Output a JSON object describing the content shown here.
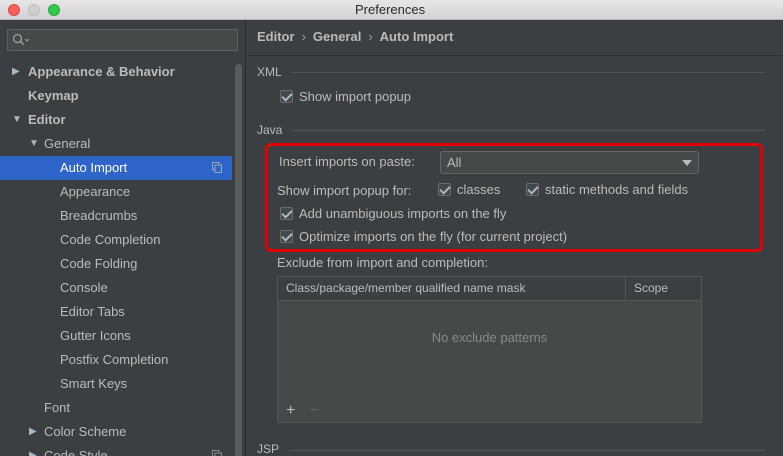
{
  "window": {
    "title": "Preferences"
  },
  "search": {
    "placeholder": ""
  },
  "sidebar": {
    "items": [
      {
        "label": "Appearance & Behavior",
        "arrow": "▶",
        "bold": true
      },
      {
        "label": "Keymap",
        "arrow": "",
        "bold": true
      },
      {
        "label": "Editor",
        "arrow": "▼",
        "bold": true
      },
      {
        "label": "General",
        "arrow": "▼",
        "bold": false
      },
      {
        "label": "Auto Import",
        "arrow": "",
        "bold": false,
        "selected": true
      },
      {
        "label": "Appearance",
        "arrow": "",
        "bold": false
      },
      {
        "label": "Breadcrumbs",
        "arrow": "",
        "bold": false
      },
      {
        "label": "Code Completion",
        "arrow": "",
        "bold": false
      },
      {
        "label": "Code Folding",
        "arrow": "",
        "bold": false
      },
      {
        "label": "Console",
        "arrow": "",
        "bold": false
      },
      {
        "label": "Editor Tabs",
        "arrow": "",
        "bold": false
      },
      {
        "label": "Gutter Icons",
        "arrow": "",
        "bold": false
      },
      {
        "label": "Postfix Completion",
        "arrow": "",
        "bold": false
      },
      {
        "label": "Smart Keys",
        "arrow": "",
        "bold": false
      },
      {
        "label": "Font",
        "arrow": "",
        "bold": false
      },
      {
        "label": "Color Scheme",
        "arrow": "▶",
        "bold": false
      },
      {
        "label": "Code Style",
        "arrow": "▶",
        "bold": false
      }
    ]
  },
  "breadcrumb": {
    "parts": [
      "Editor",
      "General",
      "Auto Import"
    ],
    "separator": "›"
  },
  "xml": {
    "title": "XML",
    "show_import_popup": {
      "label": "Show import popup",
      "checked": true
    }
  },
  "java": {
    "title": "Java",
    "insert_imports_label": "Insert imports on paste:",
    "insert_imports_value": "All",
    "show_popup_for_label": "Show import popup for:",
    "classes": {
      "label": "classes",
      "checked": true
    },
    "static_methods": {
      "label": "static methods and fields",
      "checked": true
    },
    "add_unambiguous": {
      "label": "Add unambiguous imports on the fly",
      "checked": true
    },
    "optimize_imports": {
      "label": "Optimize imports on the fly (for current project)",
      "checked": true
    },
    "exclude_label": "Exclude from import and completion:",
    "table": {
      "columns": [
        "Class/package/member qualified name mask",
        "Scope"
      ],
      "empty_text": "No exclude patterns",
      "add_label": "+",
      "remove_label": "−"
    }
  },
  "jsp": {
    "title": "JSP"
  },
  "colors": {
    "selection": "#2f65ca",
    "highlight_border": "#e00000",
    "background": "#3c3f41"
  }
}
